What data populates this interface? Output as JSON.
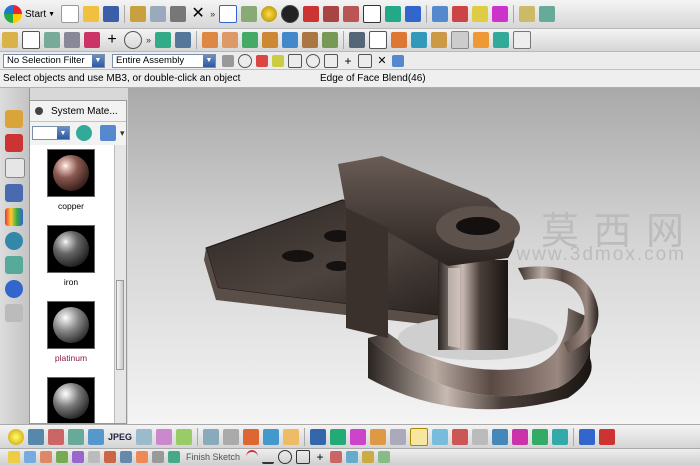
{
  "toolbar": {
    "start_label": "Start"
  },
  "selection_bar": {
    "filter_value": "No Selection Filter",
    "scope_value": "Entire Assembly"
  },
  "status": {
    "prompt": "Select objects and use MB3, or double-click an object",
    "title": "Edge of Face Blend(46)"
  },
  "materials_panel": {
    "title": "System Mate...",
    "materials": [
      {
        "name": "copper"
      },
      {
        "name": "iron"
      },
      {
        "name": "platinum"
      },
      {
        "name": ""
      }
    ]
  },
  "watermark": {
    "text_cn": "莫 西 网",
    "url": "www.3dmox.com"
  },
  "bottom_toolbar": {
    "jpeg_label": "JPEG",
    "finish_sketch_label": "Finish Sketch"
  },
  "colors": {
    "model": "#4a403c",
    "viewport_top": "#a9a9a9",
    "viewport_bottom": "#f4f4f4"
  }
}
